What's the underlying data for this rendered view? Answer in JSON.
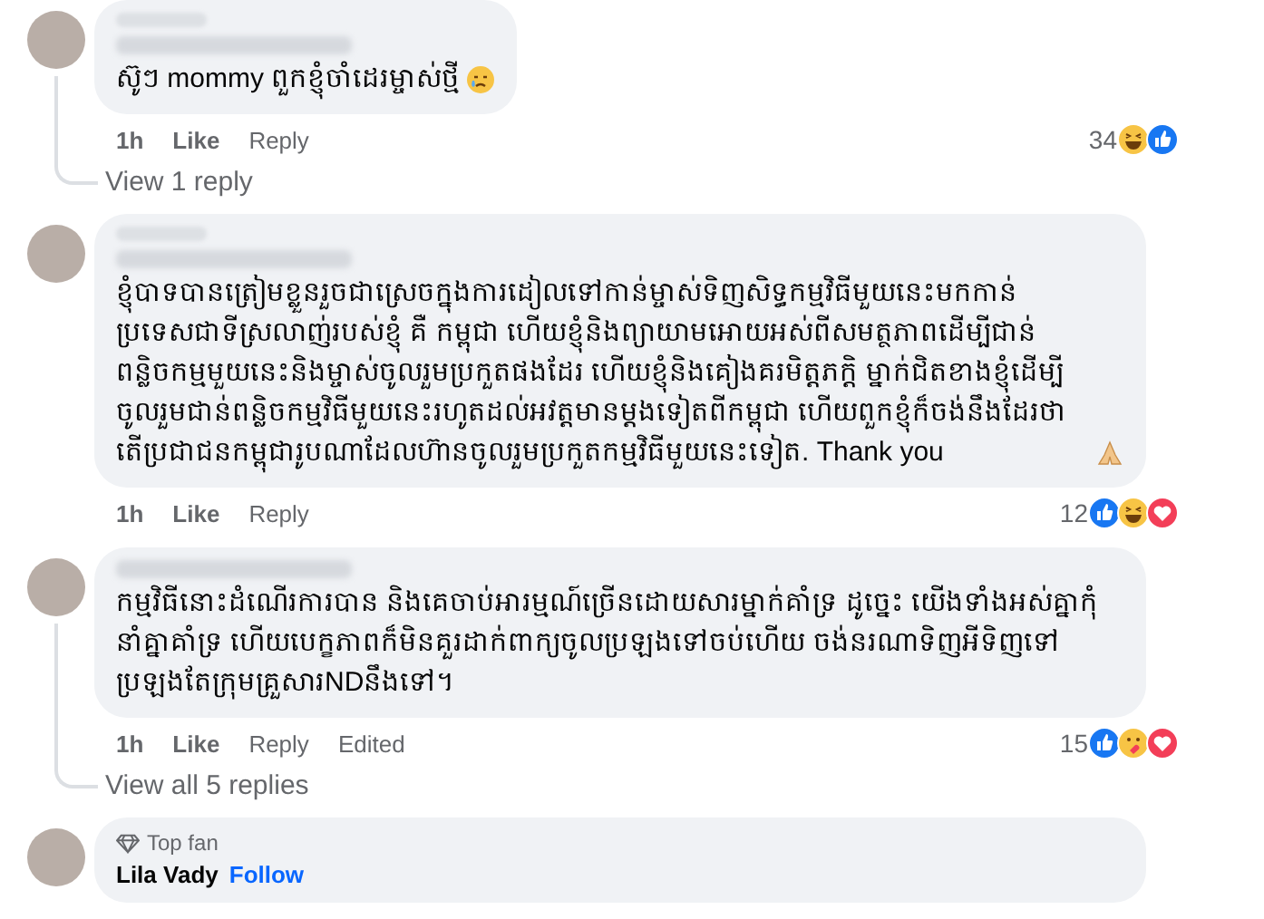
{
  "comments": [
    {
      "text": "ស៊ូៗ mommy ពួកខ្ញុំចាំដេរម្ចាស់ថ្មី",
      "blurred_badge": true,
      "emoji": {
        "kind": "sad"
      },
      "time": "1h",
      "like": "Like",
      "reply": "Reply",
      "count": "34",
      "reactions": [
        {
          "kind": "haha"
        },
        {
          "kind": "like"
        }
      ],
      "more_replies": "View 1 reply"
    },
    {
      "text": "ខ្ញុំបាទបានត្រៀមខ្លួនរួចជាស្រេចក្នុងការដៀលទៅកាន់ម្ចាស់ទិញសិទ្ធកម្មវិធីមួយនេះមកកាន់ប្រទេសជាទីស្រលាញ់របស់ខ្ញុំ គឺ កម្ពុជា ហើយខ្ញុំនិងព្យាយាមអោយអស់ពីសមត្ថភាពដើម្បីជាន់ពន្លិចកម្មមួយនេះនិងម្ចាស់ចូលរួមប្រកួតផងដែរ ហើយខ្ញុំនិងគៀងគរមិត្តភក្តិ ម្នាក់ជិតខាងខ្ញុំដើម្បីចូលរួមជាន់ពន្លិចកម្មវិធីមួយនេះរហូតដល់អវត្តមានម្តងទៀតពីកម្ពុជា ហើយពួកខ្ញុំក៏ចង់នឹងដែរថា តើប្រជាជនកម្ពុជារូបណាដែលហ៊ានចូលរួមប្រកួតកម្មវិធីមួយនេះទៀត. Thank you",
      "blurred_badge": true,
      "emoji": {
        "kind": "pray"
      },
      "time": "1h",
      "like": "Like",
      "reply": "Reply",
      "count": "12",
      "reactions": [
        {
          "kind": "like"
        },
        {
          "kind": "haha"
        },
        {
          "kind": "love"
        }
      ]
    },
    {
      "text": "កម្មវិធីនោះដំណើរការបាន និងគេចាប់អារម្មណ៍ច្រើនដោយសារម្នាក់គាំទ្រ ដូច្នេះ យើងទាំងអស់គ្នាកុំនាំគ្នាគាំទ្រ ហើយបេក្ខភាពក៏មិនគួរដាក់ពាក្យចូលប្រឡងទៅចប់ហើយ ចង់នរណាទិញអីទិញទៅប្រឡងតែក្រុមគ្រួសារNDនឹងទៅ។",
      "time": "1h",
      "like": "Like",
      "reply": "Reply",
      "blurred_badge": false,
      "edited": "Edited",
      "count": "15",
      "reactions": [
        {
          "kind": "like"
        },
        {
          "kind": "care"
        },
        {
          "kind": "love"
        }
      ],
      "more_replies": "View all 5 replies"
    },
    {
      "badge": "Top fan",
      "author": "Lila Vady",
      "follow": "Follow"
    }
  ]
}
